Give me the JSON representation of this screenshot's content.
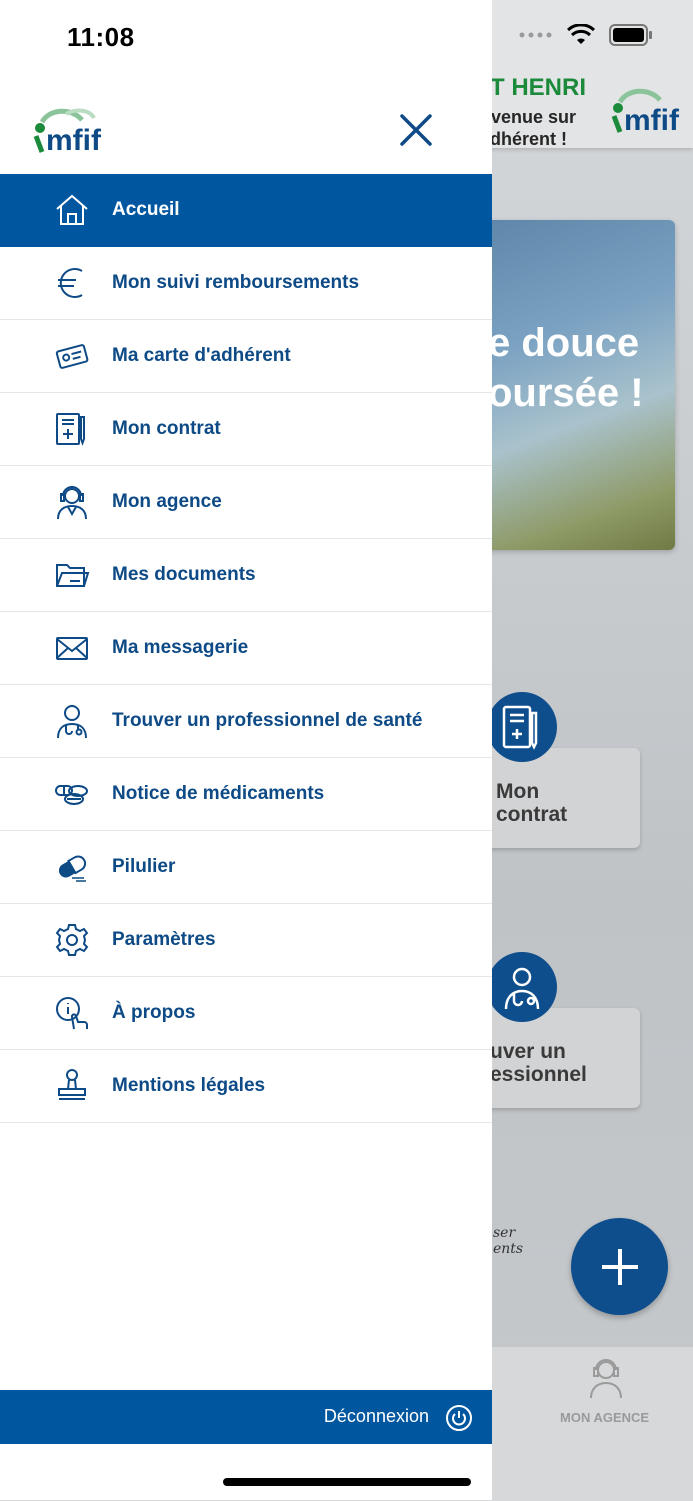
{
  "status_bar": {
    "time": "11:08"
  },
  "background_app": {
    "greeting": "T HENRI",
    "welcome_line1": "nvenue sur",
    "welcome_line2": "adhérent !",
    "banner_line1": "e douce",
    "banner_line2": "oursée !",
    "card_contract_line1": "Mon",
    "card_contract_line2": "contrat",
    "card_pro_line1": "uver un",
    "card_pro_line2": "essionnel",
    "scribble_line1": "ser",
    "scribble_line2": "ents",
    "tab_agency_label": "MON AGENCE"
  },
  "drawer": {
    "logo_text": "mfif",
    "menu": [
      {
        "label": "Accueil",
        "icon": "home-icon",
        "active": true
      },
      {
        "label": "Mon suivi remboursements",
        "icon": "euro-icon"
      },
      {
        "label": "Ma carte d'adhérent",
        "icon": "member-card-icon"
      },
      {
        "label": "Mon contrat",
        "icon": "contract-icon"
      },
      {
        "label": "Mon agence",
        "icon": "agent-headset-icon"
      },
      {
        "label": "Mes documents",
        "icon": "folder-icon"
      },
      {
        "label": "Ma messagerie",
        "icon": "envelope-icon"
      },
      {
        "label": "Trouver un professionnel de santé",
        "icon": "doctor-icon"
      },
      {
        "label": "Notice de médicaments",
        "icon": "pills-icon"
      },
      {
        "label": "Pilulier",
        "icon": "capsule-icon"
      },
      {
        "label": "Paramètres",
        "icon": "gear-icon"
      },
      {
        "label": "À propos",
        "icon": "info-icon"
      },
      {
        "label": "Mentions légales",
        "icon": "stamp-icon"
      }
    ],
    "logout_label": "Déconnexion"
  },
  "colors": {
    "primary": "#0057a0",
    "text_blue": "#0d4a86",
    "brand_green": "#1c8a3b"
  }
}
